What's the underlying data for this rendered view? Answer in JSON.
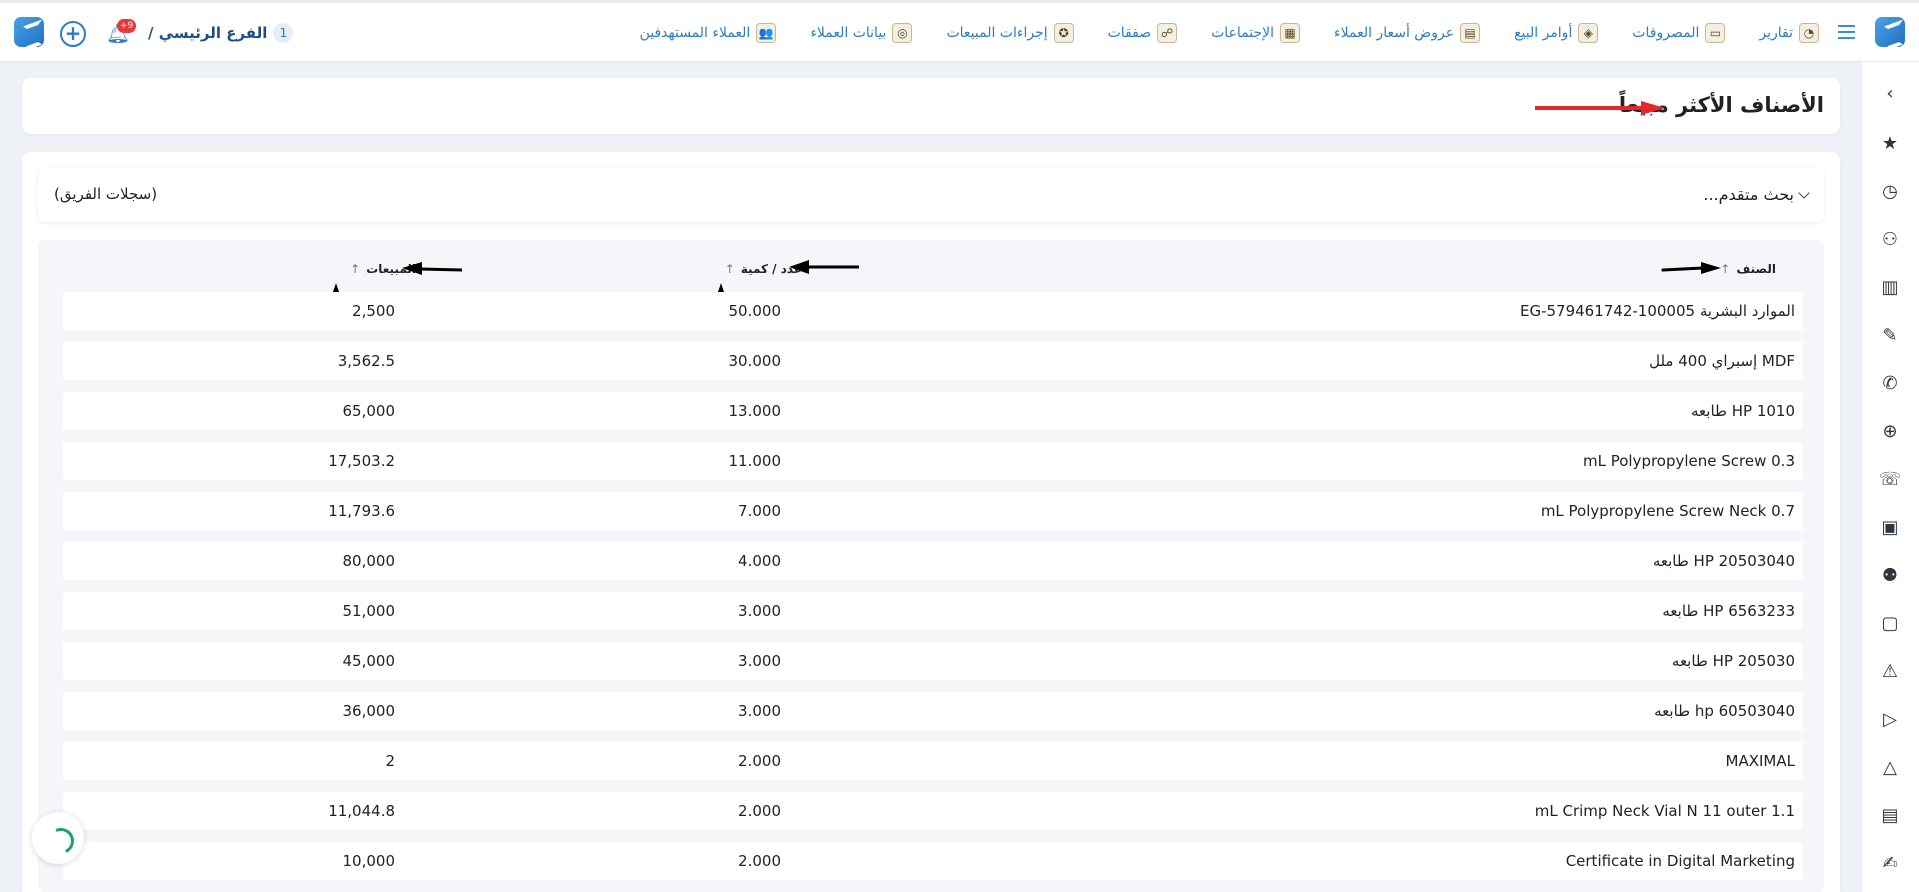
{
  "topbar": {
    "branch_label": "الفرع الرئيسي /",
    "branch_number": "1",
    "notification_count": "+9",
    "nav": [
      {
        "label": "العملاء المستهدفين",
        "icon": "target-customers-icon"
      },
      {
        "label": "بيانات العملاء",
        "icon": "customer-data-icon"
      },
      {
        "label": "إجراءات المبيعات",
        "icon": "sales-actions-icon"
      },
      {
        "label": "صفقات",
        "icon": "deals-icon"
      },
      {
        "label": "الإجتماعات",
        "icon": "meetings-icon"
      },
      {
        "label": "عروض أسعار العملاء",
        "icon": "quotes-icon"
      },
      {
        "label": "أوامر البيع",
        "icon": "sales-orders-icon"
      },
      {
        "label": "المصروفات",
        "icon": "expenses-icon"
      },
      {
        "label": "تقارير",
        "icon": "reports-icon"
      }
    ]
  },
  "page": {
    "title": "الأصناف الأكثر مبيعاً"
  },
  "search": {
    "advanced_label": "بحث متقدم...",
    "team_records": "(سجلات الفريق)"
  },
  "table": {
    "headers": {
      "item": "الصنف",
      "quantity": "عدد / كمية",
      "sales": "المبيعات"
    },
    "rows": [
      {
        "item": "EG-579461742-100005 الموارد البشرية",
        "quantity": "50.000",
        "sales": "2,500"
      },
      {
        "item": "إسبراي 400 ملل MDF",
        "quantity": "30.000",
        "sales": "3,562.5"
      },
      {
        "item": "طابعه HP 1010",
        "quantity": "13.000",
        "sales": "65,000"
      },
      {
        "item": "mL Polypropylene Screw 0.3",
        "quantity": "11.000",
        "sales": "17,503.2"
      },
      {
        "item": "mL Polypropylene Screw Neck 0.7",
        "quantity": "7.000",
        "sales": "11,793.6"
      },
      {
        "item": "طابعه HP 20503040",
        "quantity": "4.000",
        "sales": "80,000"
      },
      {
        "item": "طابعه HP 6563233",
        "quantity": "3.000",
        "sales": "51,000"
      },
      {
        "item": "طابعه HP 205030",
        "quantity": "3.000",
        "sales": "45,000"
      },
      {
        "item": "طابعه hp 60503040",
        "quantity": "3.000",
        "sales": "36,000"
      },
      {
        "item": "MAXIMAL",
        "quantity": "2.000",
        "sales": "2"
      },
      {
        "item": "mL Crimp Neck Vial N 11 outer 1.1",
        "quantity": "2.000",
        "sales": "11,044.8"
      },
      {
        "item": "Certificate in Digital Marketing",
        "quantity": "2.000",
        "sales": "10,000"
      }
    ]
  },
  "colors": {
    "accent": "#2d7cc6",
    "annotation_red": "#e5262a",
    "annotation_black": "#000000"
  }
}
